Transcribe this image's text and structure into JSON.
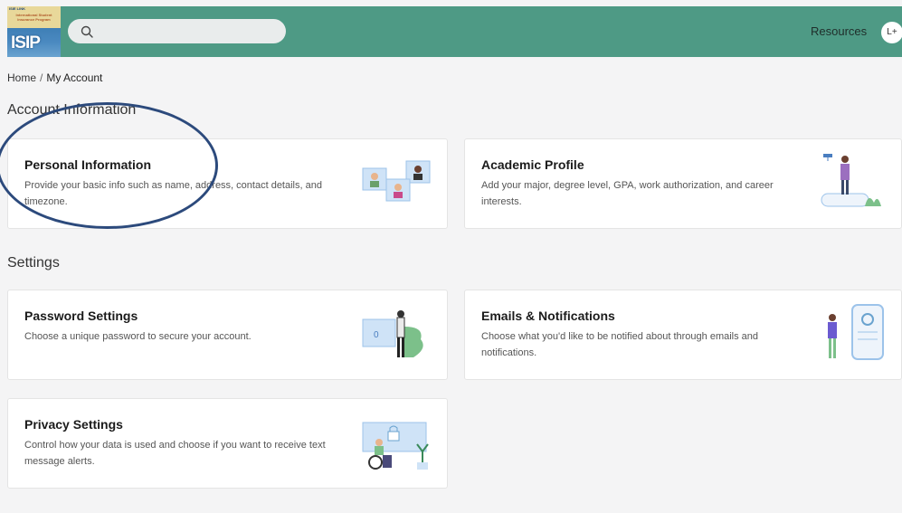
{
  "header": {
    "logo": {
      "tiny": "ISIE LINK",
      "subtitle": "International Student Insurance Program",
      "text": "ISIP"
    },
    "search": {
      "value": "",
      "placeholder": ""
    },
    "resources_label": "Resources",
    "avatar_initials": "L+"
  },
  "breadcrumb": {
    "home": "Home",
    "separator": "/",
    "current": "My Account"
  },
  "sections": {
    "account_title": "Account Information",
    "settings_title": "Settings"
  },
  "cards": {
    "personal": {
      "title": "Personal Information",
      "description": "Provide your basic info such as name, address, contact details, and timezone."
    },
    "academic": {
      "title": "Academic Profile",
      "description": "Add your major, degree level, GPA, work authorization, and career interests."
    },
    "password": {
      "title": "Password Settings",
      "description": "Choose a unique password to secure your account."
    },
    "emails": {
      "title": "Emails & Notifications",
      "description": "Choose what you'd like to be notified about through emails and notifications."
    },
    "privacy": {
      "title": "Privacy Settings",
      "description": "Control how your data is used and choose if you want to receive text message alerts."
    }
  },
  "colors": {
    "header_bg": "#4e9a85",
    "page_bg": "#f4f4f5",
    "annotation": "#2c4a7c",
    "illustration_blue": "#cfe3f7",
    "illustration_green": "#7cc08a"
  }
}
